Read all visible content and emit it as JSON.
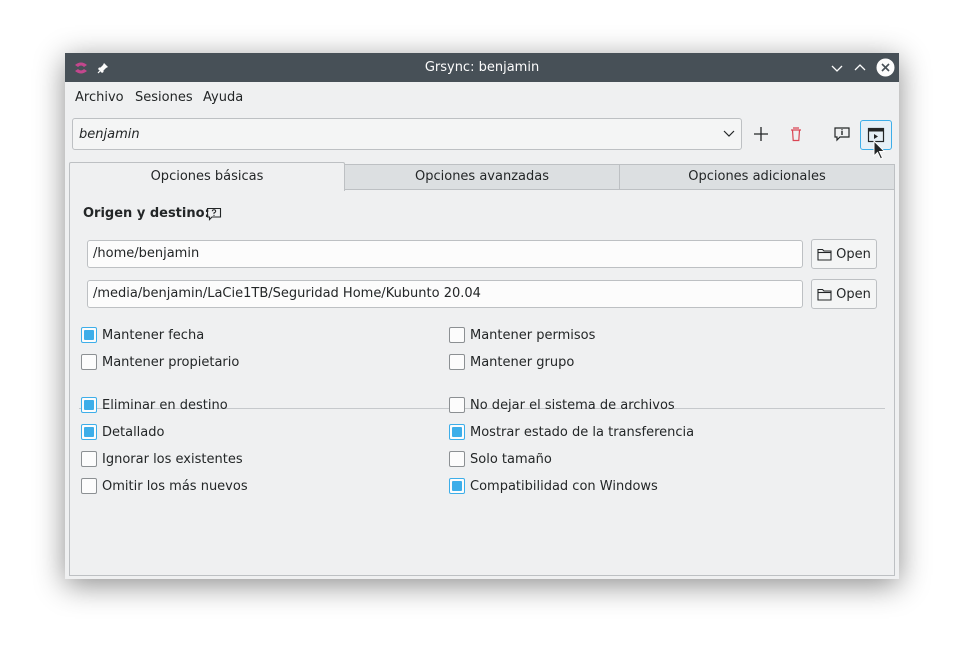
{
  "window": {
    "title": "Grsync: benjamin"
  },
  "menu": {
    "items": [
      "Archivo",
      "Sesiones",
      "Ayuda"
    ]
  },
  "session": {
    "value": "benjamin"
  },
  "tabs": [
    "Opciones básicas",
    "Opciones avanzadas",
    "Opciones adicionales"
  ],
  "basic": {
    "section_label": "Origen y destino:",
    "source_path": "/home/benjamin",
    "dest_path": "/media/benjamin/LaCie1TB/Seguridad Home/Kubunto 20.04",
    "open_label": "Open",
    "options_top": [
      {
        "label": "Mantener fecha",
        "checked": true
      },
      {
        "label": "Mantener permisos",
        "checked": false
      },
      {
        "label": "Mantener propietario",
        "checked": false
      },
      {
        "label": "Mantener grupo",
        "checked": false
      }
    ],
    "options_bottom": [
      {
        "label": "Eliminar en destino",
        "checked": true
      },
      {
        "label": "No dejar el sistema de archivos",
        "checked": false
      },
      {
        "label": "Detallado",
        "checked": true
      },
      {
        "label": "Mostrar estado de la transferencia",
        "checked": true
      },
      {
        "label": "Ignorar los existentes",
        "checked": false
      },
      {
        "label": "Solo tamaño",
        "checked": false
      },
      {
        "label": "Omitir los más nuevos",
        "checked": false
      },
      {
        "label": "Compatibilidad con Windows",
        "checked": true
      }
    ]
  },
  "colors": {
    "titlebar": "#475057",
    "accent": "#3daee9",
    "delete": "#da4453",
    "app_icon": "#c3478d"
  }
}
